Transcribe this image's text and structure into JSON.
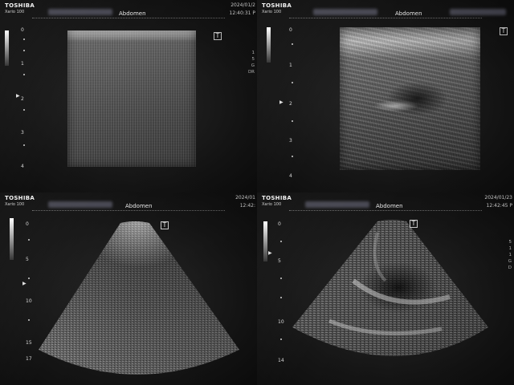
{
  "panels": [
    {
      "brand": "TOSHIBA",
      "model": "Xario 100",
      "title": "Abdomen",
      "date": "2024/01/2",
      "time": "12:40:31 P",
      "scale_labels": [
        "0",
        "1",
        "2",
        "3",
        "4"
      ],
      "side_text": [
        "1",
        "5",
        "G",
        "DR"
      ]
    },
    {
      "brand": "TOSHIBA",
      "model": "Xario 100",
      "title": "Abdomen",
      "date": "",
      "time": "",
      "scale_labels": [
        "0",
        "1",
        "2",
        "3",
        "4"
      ],
      "side_text": []
    },
    {
      "brand": "TOSHIBA",
      "model": "Xario 100",
      "title": "Abdomen",
      "date": "2024/01",
      "time": "12:42:",
      "scale_labels": [
        "0",
        "5",
        "10",
        "15",
        "17"
      ],
      "side_text": []
    },
    {
      "brand": "TOSHIBA",
      "model": "Xario 100",
      "title": "Abdomen",
      "date": "2024/01/23",
      "time": "12:42:45 P",
      "scale_labels": [
        "0",
        "5",
        "10",
        "14"
      ],
      "side_text": [
        "5",
        "1",
        "1",
        "G",
        "D"
      ]
    }
  ],
  "probe_mark": "T",
  "colors": {
    "background": "#0b0b0b",
    "text": "#e6e6e6",
    "graybar_top": "#ffffff"
  }
}
